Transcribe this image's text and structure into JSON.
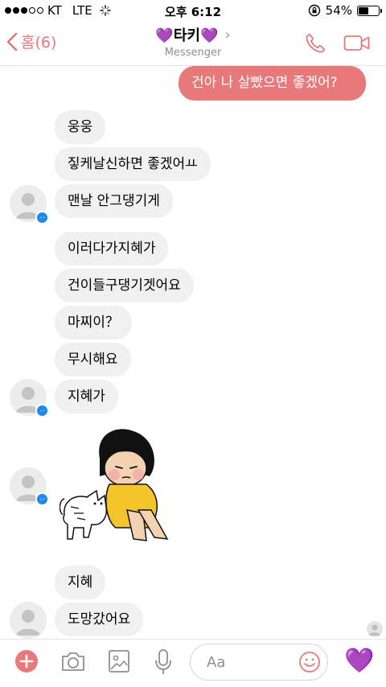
{
  "status_bar": {
    "carrier": "KT",
    "network": "LTE",
    "time": "오후 6:12",
    "battery": "54%",
    "battery_level": 0.54
  },
  "header": {
    "back_label": "홈(6)",
    "title": "💜타키💜",
    "subtitle": "Messenger"
  },
  "messages": [
    {
      "from": "me",
      "text": "건아 나 살빴으면 좋겠어?"
    },
    {
      "from": "them",
      "text": "웅웅"
    },
    {
      "from": "them",
      "text": "짛케날신하면 좋겠어ㅛ"
    },
    {
      "from": "them",
      "text": "맨날 안그댕기게"
    },
    {
      "from": "them",
      "text": "이러다가지혜가"
    },
    {
      "from": "them",
      "text": "건이들구댕기겟어요"
    },
    {
      "from": "them",
      "text": "마찌이？"
    },
    {
      "from": "them",
      "text": "무시해요"
    },
    {
      "from": "them",
      "text": "지혜가"
    },
    {
      "from": "them",
      "type": "sticker",
      "sticker": "girl-with-cat-sticker"
    },
    {
      "from": "them",
      "text": "지혜"
    },
    {
      "from": "them",
      "text": "도망갔어요"
    }
  ],
  "composer": {
    "placeholder": "Aa",
    "like_emoji": "💜"
  },
  "colors": {
    "accent": "#e8797a",
    "incoming_bubble": "#f0f0f0",
    "messenger_badge": "#1e88f0"
  }
}
